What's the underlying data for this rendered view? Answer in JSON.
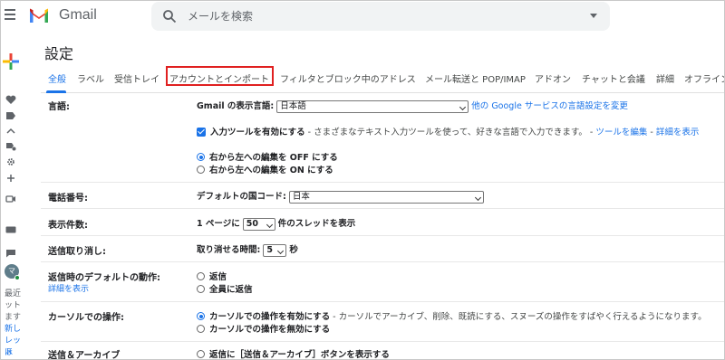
{
  "app": {
    "name": "Gmail"
  },
  "search": {
    "placeholder": "メールを検索"
  },
  "page_title": "設定",
  "tabs": [
    {
      "label": "全般"
    },
    {
      "label": "ラベル"
    },
    {
      "label": "受信トレイ"
    },
    {
      "label": "アカウントとインポート"
    },
    {
      "label": "フィルタとブロック中のアドレス"
    },
    {
      "label": "メール転送と POP/IMAP"
    },
    {
      "label": "アドオン"
    },
    {
      "label": "チャットと会議"
    },
    {
      "label": "詳細"
    },
    {
      "label": "オフライン"
    }
  ],
  "rail": {
    "recent_text": "最近",
    "recent_text2": "ット",
    "recent_text3": "ます",
    "new_text": "新し",
    "new_text2": "レット",
    "new_text3": "ほ",
    "avatar_initial": "マ"
  },
  "settings": {
    "language": {
      "label": "言語:",
      "display_language_label": "Gmail の表示言語:",
      "display_language_value": "日本語",
      "other_services_link": "他の Google サービスの言語設定を変更",
      "input_tools_label": "入力ツールを有効にする",
      "input_tools_desc": " - さまざまなテキスト入力ツールを使って、好きな言語で入力できます。 - ",
      "input_tools_edit_link": "ツールを編集",
      "input_tools_sep": " - ",
      "input_tools_more_link": "詳細を表示",
      "rtl_off": "右から左への編集を OFF にする",
      "rtl_on": "右から左への編集を ON にする"
    },
    "phone": {
      "label": "電話番号:",
      "default_country_label": "デフォルトの国コード:",
      "default_country_value": "日本"
    },
    "page_size": {
      "label": "表示件数:",
      "prefix": "1 ページに",
      "value": "50",
      "suffix": "件のスレッドを表示"
    },
    "undo_send": {
      "label": "送信取り消し:",
      "cancel_period_label": "取り消せる時間:",
      "value": "5",
      "unit": "秒"
    },
    "reply_default": {
      "label": "返信時のデフォルトの動作:",
      "more_link": "詳細を表示",
      "option1": "返信",
      "option2": "全員に返信"
    },
    "cursor": {
      "label": "カーソルでの操作:",
      "enable_label": "カーソルでの操作を有効にする",
      "enable_desc": " - カーソルでアーカイブ、削除、既読にする、スヌーズの操作をすばやく行えるようになります。",
      "disable_label": "カーソルでの操作を無効にする"
    },
    "send_archive": {
      "label": "送信＆アーカイブ",
      "option1": "返信に［送信＆アーカイブ］ボタンを表示する"
    }
  },
  "colors": {
    "accent": "#1a73e8",
    "highlight": "#e02020",
    "gmail_red": "#ea4335"
  }
}
